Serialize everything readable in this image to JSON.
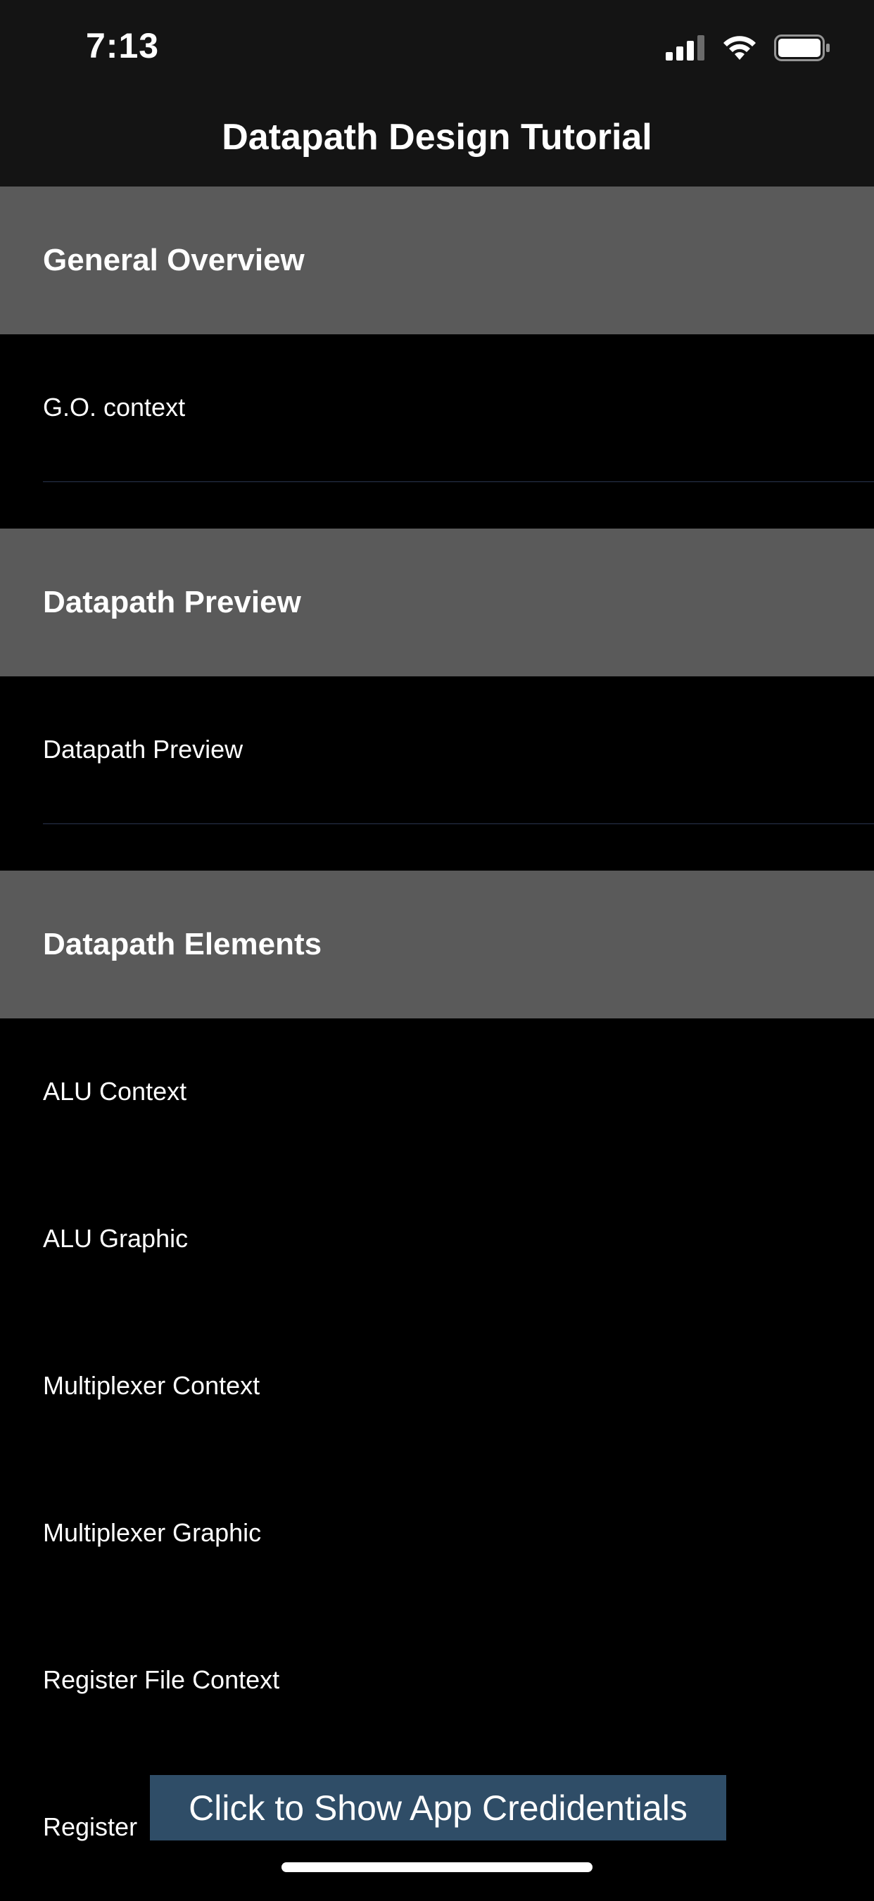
{
  "status_bar": {
    "time": "7:13"
  },
  "nav": {
    "title": "Datapath Design Tutorial"
  },
  "sections": [
    {
      "title": "General Overview",
      "items": [
        "G.O. context"
      ]
    },
    {
      "title": "Datapath Preview",
      "items": [
        "Datapath Preview"
      ]
    },
    {
      "title": "Datapath Elements",
      "items": [
        "ALU Context",
        "ALU Graphic",
        "Multiplexer Context",
        "Multiplexer Graphic",
        "Register File Context",
        "Register"
      ]
    }
  ],
  "banner": {
    "label": "Click to Show App Credidentials"
  },
  "colors": {
    "section_header_bg": "#5a5a5a",
    "banner_bg": "#2f4d67",
    "separator": "#2a3550"
  }
}
